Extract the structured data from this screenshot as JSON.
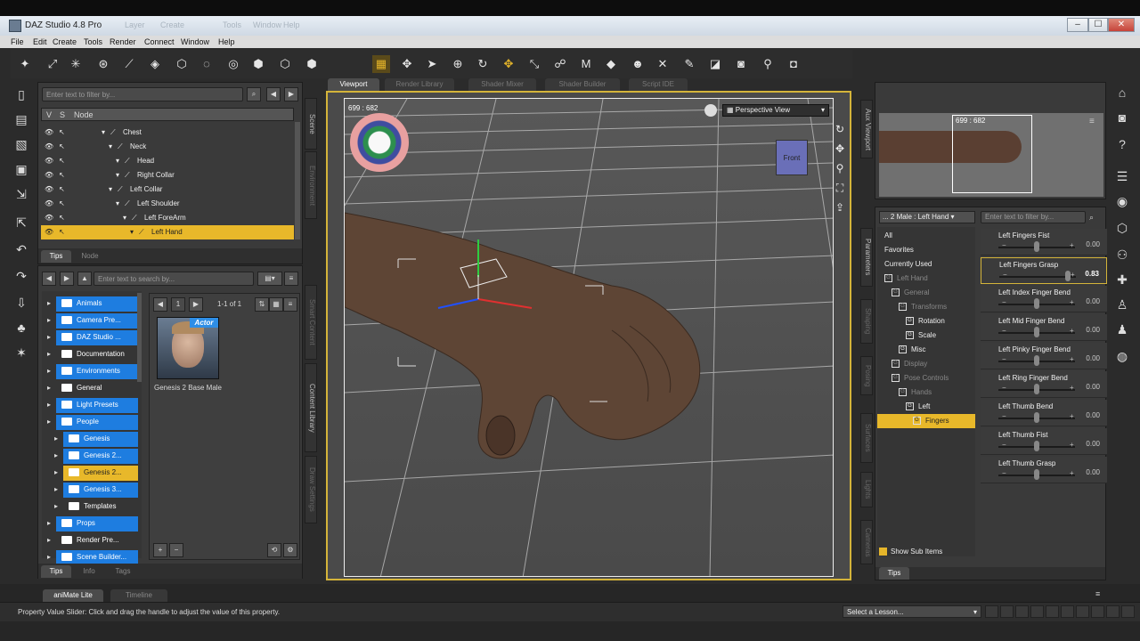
{
  "window": {
    "title": "DAZ Studio 4.8 Pro",
    "ghost_menu": [
      "Layer",
      "Create",
      "Tools",
      "Window",
      "Help"
    ],
    "controls": {
      "minimize": "–",
      "maximize": "☐",
      "close": "✕"
    }
  },
  "menu": [
    "File",
    "Edit",
    "Create",
    "Tools",
    "Render",
    "Connect",
    "Window",
    "Help"
  ],
  "scene": {
    "filter_placeholder": "Enter text to filter by...",
    "col_v": "V",
    "col_s": "S",
    "col_node": "Node",
    "nodes": [
      {
        "label": "Chest",
        "indent": 0
      },
      {
        "label": "Neck",
        "indent": 1
      },
      {
        "label": "Head",
        "indent": 2
      },
      {
        "label": "Right Collar",
        "indent": 2
      },
      {
        "label": "Left Collar",
        "indent": 1
      },
      {
        "label": "Left Shoulder",
        "indent": 2
      },
      {
        "label": "Left ForeArm",
        "indent": 3
      },
      {
        "label": "Left Hand",
        "indent": 4
      }
    ],
    "tabs": [
      "Tips",
      "Node"
    ]
  },
  "content": {
    "search_placeholder": "Enter text to search by...",
    "page": "1",
    "page_of": "1-1 of 1",
    "folders": [
      {
        "label": "Animals",
        "indent": 0,
        "sel": true
      },
      {
        "label": "Camera Pre...",
        "indent": 0,
        "sel": true
      },
      {
        "label": "DAZ Studio ...",
        "indent": 0,
        "sel": true
      },
      {
        "label": "Documentation",
        "indent": 0,
        "sel": false
      },
      {
        "label": "Environments",
        "indent": 0,
        "sel": true
      },
      {
        "label": "General",
        "indent": 0,
        "sel": false
      },
      {
        "label": "Light Presets",
        "indent": 0,
        "sel": true
      },
      {
        "label": "People",
        "indent": 0,
        "sel": true
      },
      {
        "label": "Genesis",
        "indent": 1,
        "sel": true
      },
      {
        "label": "Genesis 2...",
        "indent": 1,
        "sel": true
      },
      {
        "label": "Genesis 2...",
        "indent": 1,
        "sel": false,
        "active": true
      },
      {
        "label": "Genesis 3...",
        "indent": 1,
        "sel": true
      },
      {
        "label": "Templates",
        "indent": 1,
        "sel": false
      },
      {
        "label": "Props",
        "indent": 0,
        "sel": true
      },
      {
        "label": "Render Pre...",
        "indent": 0,
        "sel": false
      },
      {
        "label": "Scene Builder...",
        "indent": 0,
        "sel": true
      }
    ],
    "product": {
      "badge": "Actor",
      "name": "Genesis 2 Base Male"
    },
    "tabs": [
      "Tips",
      "Info",
      "Tags"
    ]
  },
  "left_vtabs": [
    "Scene",
    "Environment",
    "Smart Content",
    "Content Library",
    "Draw Settings"
  ],
  "viewport": {
    "tabs": [
      "Viewport",
      "Render Library",
      "Shader Mixer",
      "Shader Builder",
      "Script IDE"
    ],
    "view_label": "Perspective View",
    "coords": "699 : 682",
    "cube_label": "Front"
  },
  "aux": {
    "vtab": "Aux Viewport",
    "coords": "699 : 682"
  },
  "params": {
    "breadcrumb": "... 2 Male : Left Hand",
    "filter_placeholder": "Enter text to filter by...",
    "tree": [
      {
        "label": "All",
        "indent": 0
      },
      {
        "label": "Favorites",
        "indent": 0
      },
      {
        "label": "Currently Used",
        "indent": 0
      },
      {
        "label": "Left Hand",
        "indent": 0,
        "dim": true
      },
      {
        "label": "General",
        "indent": 1,
        "dim": true
      },
      {
        "label": "Transforms",
        "indent": 2,
        "dim": true
      },
      {
        "label": "Rotation",
        "indent": 3
      },
      {
        "label": "Scale",
        "indent": 3
      },
      {
        "label": "Misc",
        "indent": 2
      },
      {
        "label": "Display",
        "indent": 1,
        "dim": true
      },
      {
        "label": "Pose Controls",
        "indent": 1,
        "dim": true
      },
      {
        "label": "Hands",
        "indent": 2,
        "dim": true
      },
      {
        "label": "Left",
        "indent": 3
      },
      {
        "label": "Fingers",
        "indent": 4,
        "selected": true
      }
    ],
    "sliders": [
      {
        "label": "Left Fingers Fist",
        "value": "0.00",
        "pos": 0.5
      },
      {
        "label": "Left Fingers Grasp",
        "value": "0.83",
        "pos": 0.92,
        "active": true
      },
      {
        "label": "Left Index Finger Bend",
        "value": "0.00",
        "pos": 0.5
      },
      {
        "label": "Left Mid Finger Bend",
        "value": "0.00",
        "pos": 0.5
      },
      {
        "label": "Left Pinky Finger Bend",
        "value": "0.00",
        "pos": 0.5
      },
      {
        "label": "Left Ring Finger Bend",
        "value": "0.00",
        "pos": 0.5
      },
      {
        "label": "Left Thumb Bend",
        "value": "0.00",
        "pos": 0.5
      },
      {
        "label": "Left Thumb Fist",
        "value": "0.00",
        "pos": 0.5
      },
      {
        "label": "Left Thumb Grasp",
        "value": "0.00",
        "pos": 0.5
      }
    ],
    "show_sub": "Show Sub Items",
    "tabs": [
      "Tips"
    ],
    "vtabs": [
      "Parameters",
      "Shaping",
      "Posing",
      "Surfaces",
      "Lights",
      "Cameras"
    ]
  },
  "bottom": {
    "tabs": [
      "aniMate Lite",
      "Timeline"
    ],
    "status": "Property Value Slider: Click and drag the handle to adjust the value of this property.",
    "lesson": "Select a Lesson..."
  }
}
